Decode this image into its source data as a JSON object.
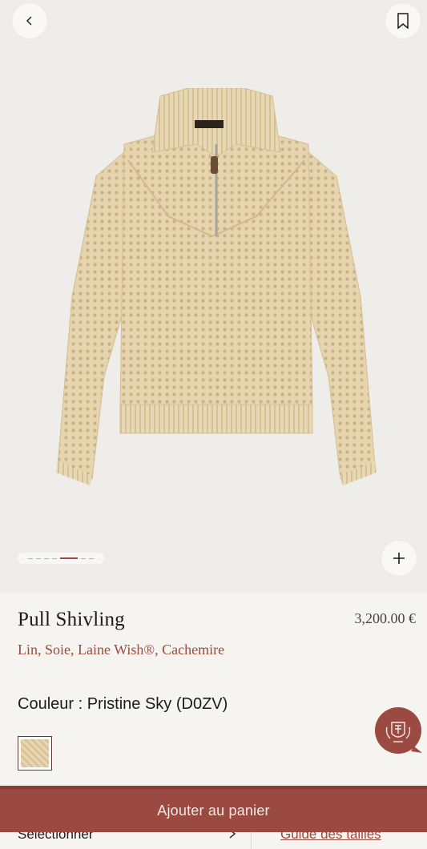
{
  "product": {
    "title": "Pull Shivling",
    "price": "3,200.00 €",
    "materials": "Lin, Soie, Laine Wish®, Cachemire",
    "color_line": "Couleur : Pristine Sky (D0ZV)"
  },
  "gallery": {
    "slide_count": 7,
    "active_index": 4
  },
  "cta": {
    "add_to_cart": "Ajouter au panier"
  },
  "size_row": {
    "select_label": "Sélectionner",
    "size_guide_label": "Guide des tailles"
  },
  "icons": {
    "back": "chevron-left-icon",
    "bookmark": "bookmark-icon",
    "zoom": "plus-icon",
    "chat": "crest-chat-icon"
  },
  "colors": {
    "accent": "#9b4a41",
    "text": "#1f1a17",
    "hero_bg": "#efedea",
    "page_bg": "#f6f4f1"
  }
}
